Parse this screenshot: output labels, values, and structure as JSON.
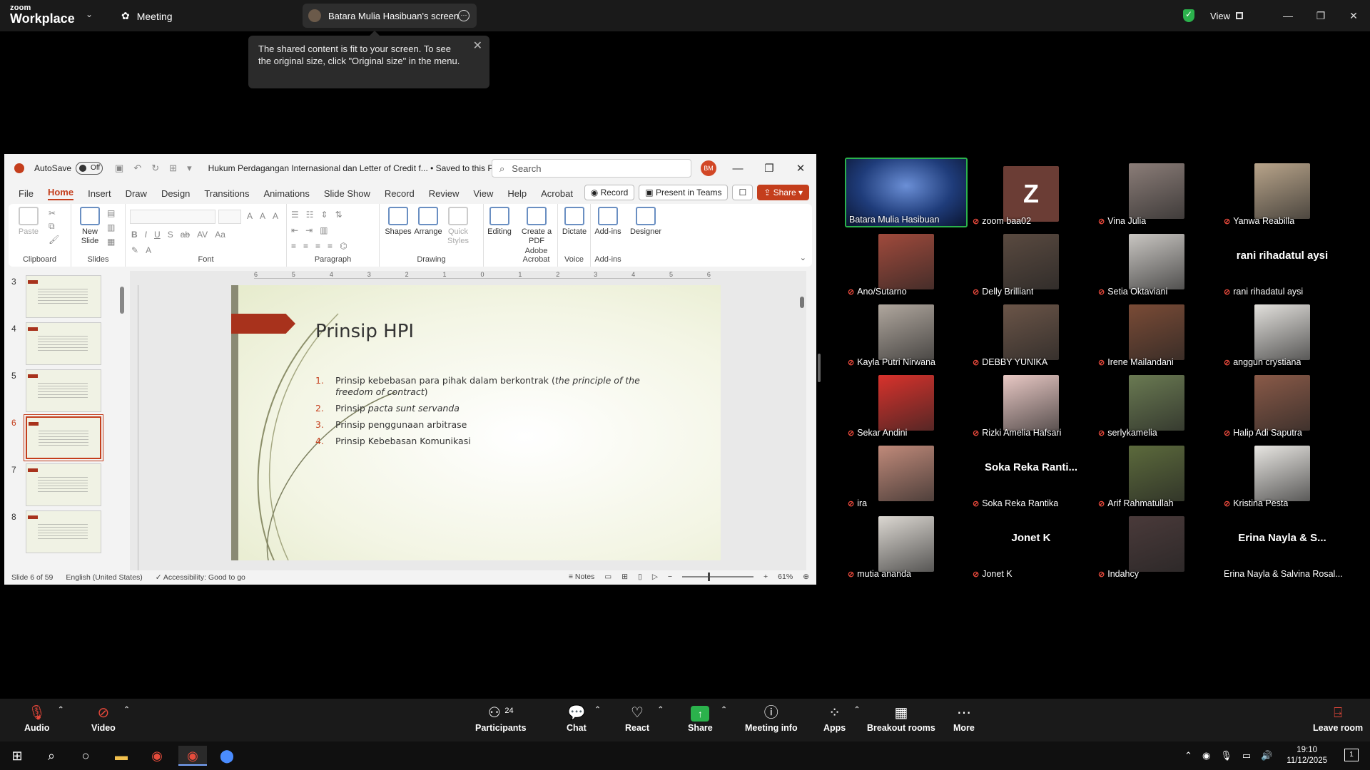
{
  "zoom": {
    "logo_line1": "zoom",
    "logo_line2": "Workplace",
    "meeting_label": "Meeting",
    "share_tab_label": "Batara Mulia Hasibuan's screen",
    "view_label": "View",
    "popover_text": "The shared content is fit to your screen. To see the original size, click \"Original size\" in the menu."
  },
  "ppt": {
    "autosave_label": "AutoSave",
    "autosave_state": "Off",
    "doc_title": "Hukum Perdagangan Internasional dan Letter of Credit f... • Saved to this PC",
    "search_placeholder": "Search",
    "user_initials": "BM",
    "menu": [
      "File",
      "Home",
      "Insert",
      "Draw",
      "Design",
      "Transitions",
      "Animations",
      "Slide Show",
      "Record",
      "Review",
      "View",
      "Help",
      "Acrobat"
    ],
    "record_btn": "Record",
    "teams_btn": "Present in Teams",
    "share_btn": "Share",
    "ribbon": {
      "paste": "Paste",
      "new_slide": "New Slide",
      "shapes": "Shapes",
      "arrange": "Arrange",
      "quick_styles": "Quick Styles",
      "editing": "Editing",
      "create_pdf": "Create a PDF",
      "dictate": "Dictate",
      "addins": "Add-ins",
      "designer": "Designer",
      "groups": {
        "clipboard": "Clipboard",
        "slides": "Slides",
        "font": "Font",
        "paragraph": "Paragraph",
        "drawing": "Drawing",
        "acrobat": "Adobe Acrobat",
        "voice": "Voice",
        "addins": "Add-ins"
      }
    },
    "thumb_numbers": [
      "3",
      "4",
      "5",
      "6",
      "7",
      "8"
    ],
    "ruler_labels": [
      "6",
      "5",
      "4",
      "3",
      "2",
      "1",
      "0",
      "1",
      "2",
      "3",
      "4",
      "5",
      "6"
    ],
    "slide": {
      "title": "Prinsip HPI",
      "items": [
        {
          "n": "1.",
          "text": "Prinsip kebebasan para pihak dalam berkontrak (",
          "italic": "the principle of the freedom of contract",
          "after": ")"
        },
        {
          "n": "2.",
          "text": "Prinsip ",
          "italic": "pacta sunt servanda",
          "after": ""
        },
        {
          "n": "3.",
          "text": "Prinsip penggunaan arbitrase",
          "italic": "",
          "after": ""
        },
        {
          "n": "4.",
          "text": "Prinsip Kebebasan Komunikasi",
          "italic": "",
          "after": ""
        }
      ]
    },
    "status": {
      "slide_count": "Slide 6 of 59",
      "language": "English (United States)",
      "accessibility": "Accessibility: Good to go",
      "notes": "Notes",
      "zoom": "61%"
    }
  },
  "participants": [
    {
      "name": "Batara Mulia Hasibuan",
      "type": "video",
      "color": "#1f3c7a",
      "muted": false
    },
    {
      "name": "zoom baa02",
      "type": "letter",
      "letter": "Z",
      "muted": true
    },
    {
      "name": "Vina Julia",
      "type": "video",
      "color": "#8b7d78",
      "muted": true
    },
    {
      "name": "Yanwa Reabilla",
      "type": "video",
      "color": "#b8a48a",
      "muted": true
    },
    {
      "name": "Ano/Sutarno",
      "type": "video",
      "color": "#a04a3c",
      "muted": true
    },
    {
      "name": "Delly Brilliant",
      "type": "video",
      "color": "#5a4a40",
      "muted": true
    },
    {
      "name": "Setia Oktaviani",
      "type": "video",
      "color": "#c9c6c2",
      "muted": true
    },
    {
      "name": "rani rihadatul aysi",
      "type": "name",
      "muted": true
    },
    {
      "name": "Kayla Putri Nirwana",
      "type": "video",
      "color": "#b0a79e",
      "muted": true
    },
    {
      "name": "DEBBY YUNIKA",
      "type": "video",
      "color": "#6b5548",
      "muted": true
    },
    {
      "name": "Irene Mailandani",
      "type": "video",
      "color": "#7a4b36",
      "muted": true
    },
    {
      "name": "anggun crystiana",
      "type": "video",
      "color": "#e2e0dc",
      "muted": true
    },
    {
      "name": "Sekar Andini",
      "type": "video",
      "color": "#d8322c",
      "muted": true
    },
    {
      "name": "Rizki Amelia Hafsari",
      "type": "video",
      "color": "#e8c8c4",
      "muted": true
    },
    {
      "name": "serlykamelia",
      "type": "video",
      "color": "#6a7a52",
      "muted": true
    },
    {
      "name": "Halip Adi Saputra",
      "type": "video",
      "color": "#8a5a48",
      "muted": true
    },
    {
      "name": "ira",
      "type": "video",
      "color": "#c08a7a",
      "muted": true
    },
    {
      "name": "Soka Reka Rantika",
      "type": "name",
      "big": "Soka Reka Ranti...",
      "muted": true
    },
    {
      "name": "Arif Rahmatullah",
      "type": "video",
      "color": "#5c6a3c",
      "muted": true
    },
    {
      "name": "Kristina Pesta",
      "type": "video",
      "color": "#e8e6e2",
      "muted": true
    },
    {
      "name": "mutia ananda",
      "type": "video",
      "color": "#dcd8d2",
      "muted": true
    },
    {
      "name": "Jonet K",
      "type": "name",
      "muted": true
    },
    {
      "name": "Indahcy",
      "type": "video",
      "color": "#4a3a3a",
      "muted": true
    },
    {
      "name": "Erina Nayla & Salvina Rosal...",
      "type": "name",
      "big": "Erina Nayla & S...",
      "muted": false
    }
  ],
  "toolbar": {
    "audio": "Audio",
    "video": "Video",
    "participants": "Participants",
    "participant_count": "24",
    "chat": "Chat",
    "react": "React",
    "share": "Share",
    "meeting_info": "Meeting info",
    "apps": "Apps",
    "breakout": "Breakout rooms",
    "more": "More",
    "leave": "Leave room"
  },
  "taskbar": {
    "time": "19:10",
    "date": "11/12/2025"
  }
}
